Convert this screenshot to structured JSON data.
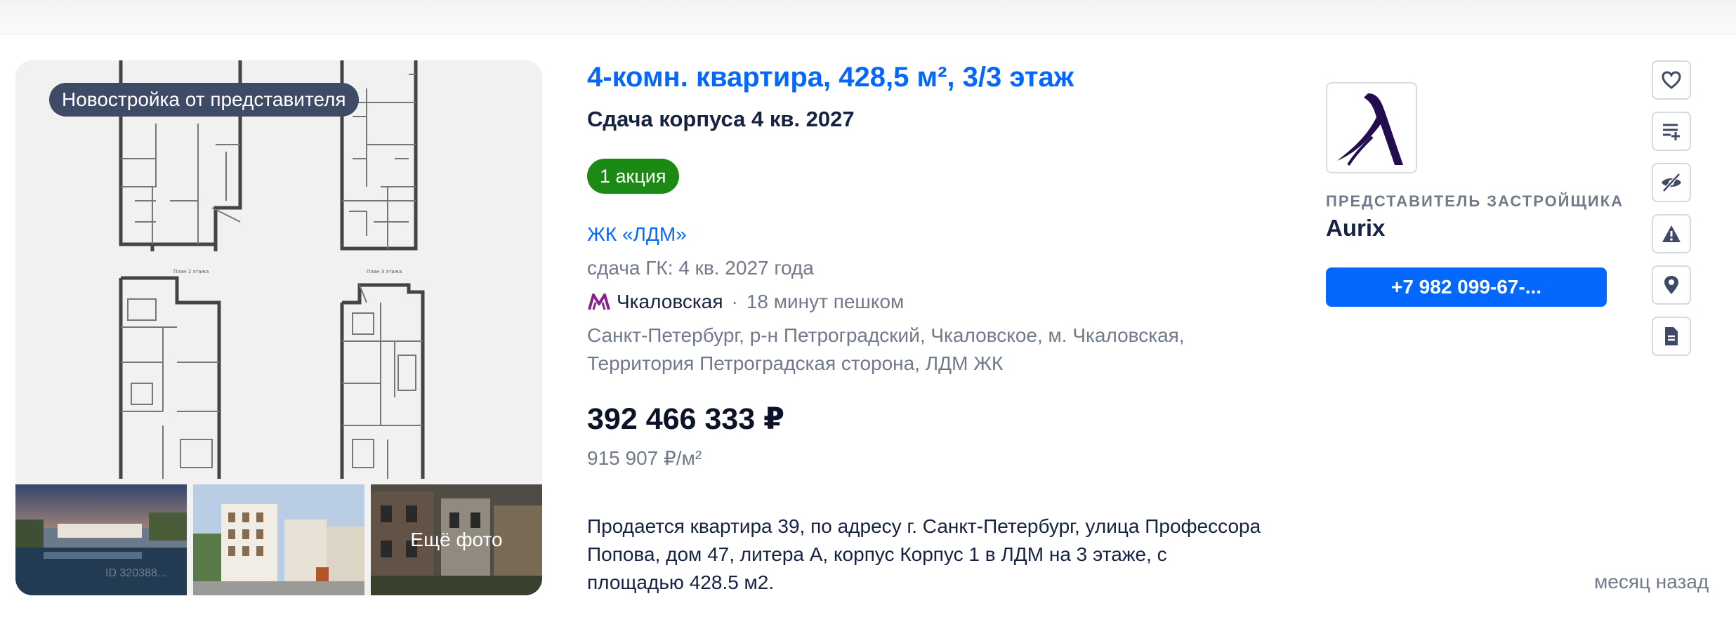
{
  "listing": {
    "badge": "Новостройка от представителя",
    "title": "4-комн. квартира, 428,5 м², 3/3 этаж",
    "subtitle": "Сдача корпуса 4 кв. 2027",
    "promo": "1 акция",
    "complex": "ЖК «ЛДМ»",
    "deadline": "сдача ГК: 4 кв. 2027 года",
    "metro": {
      "station": "Чкаловская",
      "separator": "·",
      "walk": "18 минут пешком",
      "color": "#8a1f8d"
    },
    "address": "Санкт-Петербург, р-н Петроградский, Чкаловское, м. Чкаловская, Территория Петроградская сторона, ЛДМ ЖК",
    "price": "392 466 333 ₽",
    "price_per_m2": "915 907 ₽/м²",
    "description": "Продается квартира 39, по адресу г. Санкт-Петербург, улица Профессора Попова, дом 47, литера А, корпус Корпус 1 в ЛДМ на 3 этаже, с площадью 428.5 м2.",
    "published": "месяц назад"
  },
  "gallery": {
    "more_label": "Ещё фото",
    "thumb_caption": "ID 320388..."
  },
  "agent": {
    "role": "ПРЕДСТАВИТЕЛЬ ЗАСТРОЙЩИКА",
    "name": "Aurix",
    "phone": "+7 982 099-67-...",
    "logo_icon": "lambda-logo-icon"
  },
  "actions": [
    {
      "icon": "heart-icon"
    },
    {
      "icon": "add-to-list-icon"
    },
    {
      "icon": "hide-icon"
    },
    {
      "icon": "warning-icon"
    },
    {
      "icon": "map-pin-icon"
    },
    {
      "icon": "document-icon"
    }
  ],
  "colors": {
    "accent": "#0468ff",
    "promo": "#1b8a14",
    "text": "#152242",
    "muted": "#707a8a",
    "badge": "#3e4a66"
  }
}
